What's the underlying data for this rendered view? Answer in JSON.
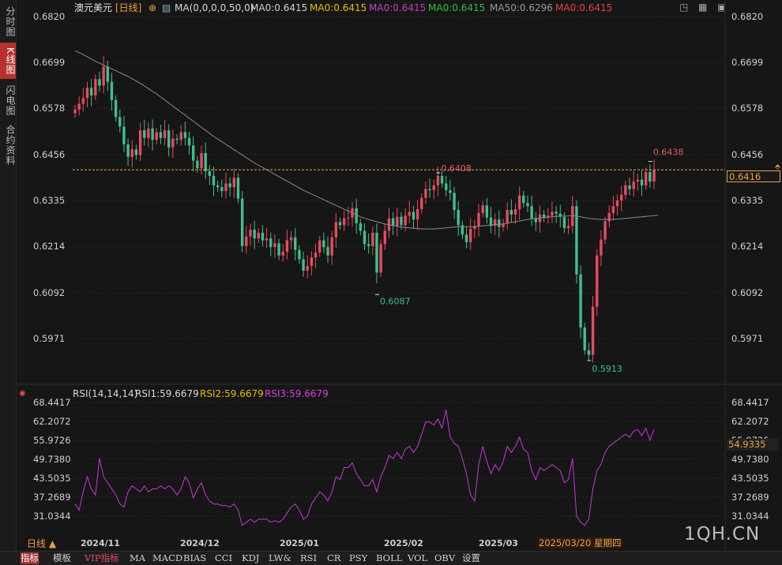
{
  "header": {
    "title": "澳元美元",
    "period": "[日线]",
    "ma_set": "MA(0,0,0,0,50,0)",
    "ma_vals": [
      {
        "text": "MA0:0.6415",
        "color": "#cfcfcf"
      },
      {
        "text": "MA0:0.6415",
        "color": "#e0c000"
      },
      {
        "text": "MA0:0.6415",
        "color": "#c43fc4"
      },
      {
        "text": "MA0:0.6415",
        "color": "#2fbf3f"
      },
      {
        "text": "MA50:0.6296",
        "color": "#9a9a9a"
      },
      {
        "text": "MA0:0.6415",
        "color": "#e84040"
      }
    ]
  },
  "sidebar": {
    "tabs": [
      "分时图",
      "K线图",
      "闪电图",
      "合约资料"
    ]
  },
  "rsi": {
    "label": "RSI(14,14,14)",
    "r1": "RSI1:59.6679",
    "r2": "RSI2:59.6679",
    "r3": "RSI3:59.6679"
  },
  "current_price": "0.6416",
  "current_rsi": "54.9335",
  "date_hover": "2025/03/20 星期四",
  "period_btn": "日线",
  "watermark": "1QH.CN",
  "bottom_tabs": [
    "指标",
    "模板",
    "VIP指标",
    "MA",
    "MACD",
    "BIAS",
    "CCI",
    "KDJ",
    "LW&",
    "RSI",
    "CR",
    "PSY",
    "BOLL",
    "VOL",
    "OBV",
    "设置"
  ],
  "colors": {
    "up": "#e84a5f",
    "down": "#3fbf8f",
    "ma50": "#8a8a8a",
    "rsi": "#c638d8",
    "cur": "#f0a040"
  },
  "chart_data": [
    {
      "type": "candlestick",
      "title": "澳元美元",
      "y_ticks": [
        "0.6820",
        "0.6699",
        "0.6578",
        "0.6456",
        "0.6335",
        "0.6214",
        "0.6092",
        "0.5971"
      ],
      "y_tick_values": [
        0.682,
        0.6699,
        0.6578,
        0.6456,
        0.6335,
        0.6214,
        0.6092,
        0.5971
      ],
      "ylim": [
        0.5971,
        0.682
      ],
      "x_labels": [
        "2024/11",
        "2024/12",
        "2025/01",
        "2025/02",
        "2025/03"
      ],
      "annotations": [
        {
          "text": "0.6438",
          "value": 0.6438
        },
        {
          "text": "0.6408",
          "value": 0.6408
        },
        {
          "text": "0.6087",
          "value": 0.6087
        },
        {
          "text": "0.5913",
          "value": 0.5913
        }
      ],
      "current_line": 0.6416,
      "closes": [
        0.6575,
        0.659,
        0.6605,
        0.6632,
        0.6612,
        0.6655,
        0.6638,
        0.6688,
        0.6648,
        0.66,
        0.6555,
        0.653,
        0.6483,
        0.645,
        0.647,
        0.6455,
        0.652,
        0.65,
        0.6525,
        0.6495,
        0.6515,
        0.65,
        0.652,
        0.6475,
        0.6498,
        0.6495,
        0.6515,
        0.65,
        0.648,
        0.644,
        0.642,
        0.646,
        0.6412,
        0.64,
        0.6375,
        0.637,
        0.636,
        0.638,
        0.637,
        0.6395,
        0.634,
        0.6215,
        0.624,
        0.6258,
        0.6235,
        0.625,
        0.623,
        0.6235,
        0.6212,
        0.6222,
        0.619,
        0.62,
        0.623,
        0.6238,
        0.6205,
        0.618,
        0.615,
        0.6162,
        0.6185,
        0.6198,
        0.623,
        0.6212,
        0.619,
        0.6238,
        0.6278,
        0.627,
        0.6288,
        0.629,
        0.6315,
        0.6275,
        0.6255,
        0.622,
        0.6215,
        0.625,
        0.6145,
        0.622,
        0.6255,
        0.6288,
        0.6268,
        0.6292,
        0.627,
        0.6295,
        0.6305,
        0.6285,
        0.6312,
        0.6342,
        0.6365,
        0.6362,
        0.6375,
        0.64,
        0.638,
        0.6362,
        0.6355,
        0.631,
        0.627,
        0.6245,
        0.6225,
        0.626,
        0.6268,
        0.6302,
        0.6322,
        0.629,
        0.6268,
        0.6285,
        0.6265,
        0.6275,
        0.631,
        0.6298,
        0.6312,
        0.6348,
        0.6328,
        0.632,
        0.6288,
        0.6278,
        0.6298,
        0.629,
        0.6295,
        0.6305,
        0.63,
        0.6292,
        0.6262,
        0.6268,
        0.632,
        0.614,
        0.6,
        0.594,
        0.5928,
        0.6055,
        0.619,
        0.6232,
        0.628,
        0.6302,
        0.632,
        0.6335,
        0.635,
        0.6375,
        0.6365,
        0.6385,
        0.639,
        0.6375,
        0.641,
        0.6385,
        0.6415
      ],
      "ma50": [
        0.673,
        0.6725,
        0.672,
        0.6714,
        0.6708,
        0.6702,
        0.6697,
        0.6692,
        0.6687,
        0.6682,
        0.6677,
        0.6672,
        0.6667,
        0.6662,
        0.6656,
        0.665,
        0.6644,
        0.6637,
        0.663,
        0.6623,
        0.6616,
        0.6608,
        0.66,
        0.6592,
        0.6584,
        0.6576,
        0.6568,
        0.656,
        0.6552,
        0.6544,
        0.6536,
        0.6528,
        0.652,
        0.6512,
        0.6504,
        0.6497,
        0.649,
        0.6483,
        0.6476,
        0.6469,
        0.6462,
        0.6455,
        0.6448,
        0.6441,
        0.6434,
        0.6428,
        0.6422,
        0.6416,
        0.641,
        0.6404,
        0.6398,
        0.6392,
        0.6386,
        0.638,
        0.6374,
        0.6368,
        0.6362,
        0.6357,
        0.6352,
        0.6347,
        0.6342,
        0.6337,
        0.6332,
        0.6327,
        0.6322,
        0.6317,
        0.6312,
        0.6307,
        0.6302,
        0.6297,
        0.6292,
        0.6288,
        0.6285,
        0.6282,
        0.6279,
        0.6276,
        0.6273,
        0.6271,
        0.6269,
        0.6267,
        0.6265,
        0.6264,
        0.6263,
        0.6262,
        0.6261,
        0.626,
        0.626,
        0.626,
        0.626,
        0.6261,
        0.6262,
        0.6263,
        0.6264,
        0.6265,
        0.6266,
        0.6266,
        0.6266,
        0.6266,
        0.6266,
        0.6267,
        0.6268,
        0.6269,
        0.627,
        0.6271,
        0.6272,
        0.6273,
        0.6275,
        0.6277,
        0.6279,
        0.6281,
        0.6283,
        0.6285,
        0.6287,
        0.6288,
        0.6289,
        0.629,
        0.6291,
        0.6292,
        0.6293,
        0.6294,
        0.6294,
        0.6294,
        0.6295,
        0.6294,
        0.6292,
        0.629,
        0.6288,
        0.6287,
        0.6286,
        0.6285,
        0.6285,
        0.6285,
        0.6285,
        0.6286,
        0.6287,
        0.6288,
        0.6289,
        0.629,
        0.6291,
        0.6292,
        0.6293,
        0.6294,
        0.6295,
        0.6296
      ]
    },
    {
      "type": "line",
      "title": "RSI(14,14,14)",
      "y_ticks": [
        "68.4417",
        "62.2072",
        "55.9726",
        "49.7380",
        "43.5035",
        "37.2689",
        "31.0344"
      ],
      "y_tick_values": [
        68.4417,
        62.2072,
        55.9726,
        49.738,
        43.5035,
        37.2689,
        31.0344
      ],
      "ylim": [
        31.0344,
        68.4417
      ],
      "series": [
        {
          "name": "RSI1",
          "values": [
            35.0,
            33.0,
            39.0,
            44.0,
            40.0,
            38.0,
            50.0,
            44.0,
            42.0,
            40.0,
            38.0,
            35.0,
            34.0,
            39.0,
            41.0,
            40.0,
            39.0,
            41.0,
            39.0,
            40.0,
            40.0,
            41.0,
            40.0,
            41.0,
            40.0,
            38.0,
            40.0,
            44.0,
            42.0,
            37.0,
            40.0,
            42.0,
            38.0,
            36.0,
            35.0,
            35.0,
            34.5,
            34.5,
            34.0,
            35.0,
            33.0,
            28.0,
            29.0,
            30.0,
            29.0,
            30.0,
            30.0,
            30.0,
            29.0,
            29.5,
            29.0,
            30.0,
            32.0,
            34.0,
            35.0,
            33.0,
            30.0,
            31.0,
            35.0,
            37.0,
            39.0,
            38.0,
            36.0,
            39.0,
            44.0,
            43.0,
            47.0,
            47.0,
            48.5,
            45.0,
            43.0,
            41.0,
            41.0,
            43.0,
            39.0,
            44.0,
            47.0,
            51.0,
            50.0,
            52.0,
            50.0,
            53.0,
            54.0,
            52.0,
            54.0,
            58.0,
            62.0,
            62.0,
            61.0,
            63.0,
            60.0,
            66.0,
            57.0,
            55.0,
            54.0,
            50.0,
            45.0,
            38.0,
            36.0,
            48.0,
            54.0,
            49.0,
            45.0,
            48.0,
            46.0,
            49.0,
            54.0,
            52.0,
            54.0,
            57.0,
            53.0,
            52.0,
            46.0,
            43.0,
            47.0,
            46.0,
            47.0,
            48.0,
            47.0,
            46.0,
            42.0,
            43.0,
            50.0,
            31.0,
            29.0,
            28.0,
            30.0,
            40.0,
            46.0,
            48.0,
            52.0,
            54.0,
            55.0,
            56.0,
            57.0,
            58.0,
            57.0,
            59.0,
            59.5,
            57.5,
            60.0,
            56.0,
            59.6
          ]
        }
      ]
    }
  ]
}
